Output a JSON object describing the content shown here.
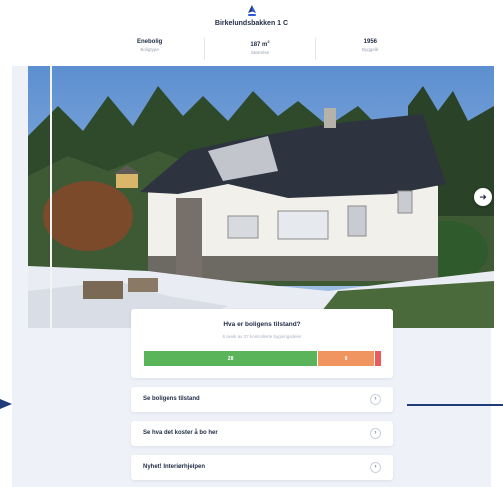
{
  "header": {
    "address": "Birkelundsbakken 1 C",
    "facts": [
      {
        "value": "Enebolig",
        "label": "Boligtype"
      },
      {
        "value": "187 m",
        "unit_sup": "2",
        "label": "Størrelse"
      },
      {
        "value": "1956",
        "label": "Byggeår"
      }
    ]
  },
  "status": {
    "title": "Hva er boligens tilstand?",
    "subtitle": "6 avvik av 37 kontrollerte bygningsdeler",
    "good": 28,
    "moderate": 9,
    "severe": 1,
    "good_label": "28",
    "moderate_label": "9",
    "colors": {
      "good": "#5ab55a",
      "moderate": "#f19560",
      "severe": "#ec5b5b"
    }
  },
  "links": [
    {
      "label": "Se boligens tilstand"
    },
    {
      "label": "Se hva det koster å bo her"
    },
    {
      "label": "Nyhet! Interiørhjelpen"
    }
  ],
  "icons": {
    "next": "arrow-right-icon",
    "chevron": "chevron-right-icon",
    "logo": "logo-icon"
  }
}
